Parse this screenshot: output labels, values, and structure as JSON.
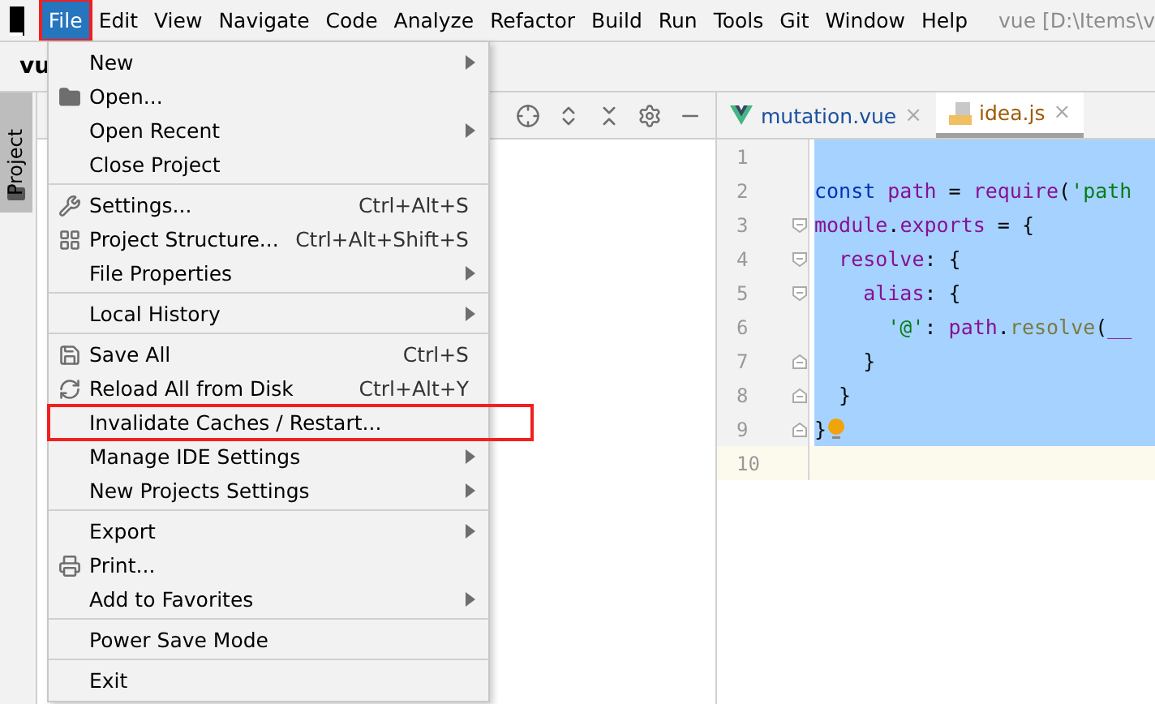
{
  "menu_bar": {
    "items": [
      {
        "label": "File",
        "selected": true,
        "annotated": true
      },
      {
        "label": "Edit",
        "selected": false,
        "annotated": false
      },
      {
        "label": "View",
        "selected": false,
        "annotated": false
      },
      {
        "label": "Navigate",
        "selected": false,
        "annotated": false
      },
      {
        "label": "Code",
        "selected": false,
        "annotated": false
      },
      {
        "label": "Analyze",
        "selected": false,
        "annotated": false
      },
      {
        "label": "Refactor",
        "selected": false,
        "annotated": false
      },
      {
        "label": "Build",
        "selected": false,
        "annotated": false
      },
      {
        "label": "Run",
        "selected": false,
        "annotated": false
      },
      {
        "label": "Tools",
        "selected": false,
        "annotated": false
      },
      {
        "label": "Git",
        "selected": false,
        "annotated": false
      },
      {
        "label": "Window",
        "selected": false,
        "annotated": false
      },
      {
        "label": "Help",
        "selected": false,
        "annotated": false
      }
    ],
    "window_title": "vue [D:\\Items\\v"
  },
  "project_title": "vu",
  "sidebar": {
    "tab": "Project"
  },
  "file_menu": {
    "groups": [
      [
        {
          "label": "New",
          "kind": "plain",
          "submenu": true,
          "annotated": false
        },
        {
          "label": "Open...",
          "kind": "folder",
          "submenu": false,
          "annotated": false
        },
        {
          "label": "Open Recent",
          "kind": "plain",
          "submenu": true,
          "annotated": false
        },
        {
          "label": "Close Project",
          "kind": "plain",
          "submenu": false,
          "annotated": false
        }
      ],
      [
        {
          "label": "Settings...",
          "kind": "wrench",
          "shortcut": "Ctrl+Alt+S",
          "submenu": false,
          "annotated": false
        },
        {
          "label": "Project Structure...",
          "kind": "structure",
          "shortcut": "Ctrl+Alt+Shift+S",
          "submenu": false,
          "annotated": false
        },
        {
          "label": "File Properties",
          "kind": "plain",
          "submenu": true,
          "annotated": false
        }
      ],
      [
        {
          "label": "Local History",
          "kind": "plain",
          "submenu": true,
          "annotated": false
        }
      ],
      [
        {
          "label": "Save All",
          "kind": "save",
          "shortcut": "Ctrl+S",
          "submenu": false,
          "annotated": false
        },
        {
          "label": "Reload All from Disk",
          "kind": "reload",
          "shortcut": "Ctrl+Alt+Y",
          "submenu": false,
          "annotated": false
        },
        {
          "label": "Invalidate Caches / Restart...",
          "kind": "plain",
          "submenu": false,
          "annotated": true
        },
        {
          "label": "Manage IDE Settings",
          "kind": "plain",
          "submenu": true,
          "annotated": false
        },
        {
          "label": "New Projects Settings",
          "kind": "plain",
          "submenu": true,
          "annotated": false
        }
      ],
      [
        {
          "label": "Export",
          "kind": "plain",
          "submenu": true,
          "annotated": false
        },
        {
          "label": "Print...",
          "kind": "print",
          "submenu": false,
          "annotated": false
        },
        {
          "label": "Add to Favorites",
          "kind": "plain",
          "submenu": true,
          "annotated": false
        }
      ],
      [
        {
          "label": "Power Save Mode",
          "kind": "plain",
          "submenu": false,
          "annotated": false
        }
      ],
      [
        {
          "label": "Exit",
          "kind": "plain",
          "submenu": false,
          "annotated": false
        }
      ]
    ]
  },
  "editor_tabs": [
    {
      "label": "mutation.vue",
      "kind": "vue",
      "selected": false,
      "close": "×"
    },
    {
      "label": "idea.js",
      "kind": "js",
      "selected": true,
      "close": "×"
    }
  ],
  "editor": {
    "lines": [
      {
        "number": "1",
        "selected": true,
        "current": false,
        "bulb": false,
        "kind": "plain"
      },
      {
        "number": "2",
        "selected": true,
        "current": false,
        "bulb": false,
        "kind": "plain",
        "tokens": [
          {
            "kind": "keyword",
            "text": "const "
          },
          {
            "kind": "ident",
            "text": "path"
          },
          {
            "kind": "punct",
            "text": " = "
          },
          {
            "kind": "ident",
            "text": "require"
          },
          {
            "kind": "punct",
            "text": "("
          },
          {
            "kind": "string",
            "text": "'path"
          }
        ]
      },
      {
        "number": "3",
        "selected": true,
        "current": false,
        "bulb": false,
        "kind": "foldstart",
        "tokens": [
          {
            "kind": "ident",
            "text": "module"
          },
          {
            "kind": "punct",
            "text": "."
          },
          {
            "kind": "ident",
            "text": "exports"
          },
          {
            "kind": "punct",
            "text": " = {"
          }
        ]
      },
      {
        "number": "4",
        "selected": true,
        "current": false,
        "bulb": false,
        "kind": "foldstart",
        "tokens": [
          {
            "kind": "ident",
            "text": "  resolve"
          },
          {
            "kind": "punct",
            "text": ": {"
          }
        ]
      },
      {
        "number": "5",
        "selected": true,
        "current": false,
        "bulb": false,
        "kind": "foldstart",
        "tokens": [
          {
            "kind": "ident",
            "text": "    alias"
          },
          {
            "kind": "punct",
            "text": ": {"
          }
        ]
      },
      {
        "number": "6",
        "selected": true,
        "current": false,
        "bulb": false,
        "kind": "plain",
        "tokens": [
          {
            "kind": "string",
            "text": "      '@'"
          },
          {
            "kind": "punct",
            "text": ": "
          },
          {
            "kind": "ident",
            "text": "path"
          },
          {
            "kind": "punct",
            "text": "."
          },
          {
            "kind": "func",
            "text": "resolve"
          },
          {
            "kind": "punct",
            "text": "("
          },
          {
            "kind": "ident",
            "text": "__"
          }
        ]
      },
      {
        "number": "7",
        "selected": true,
        "current": false,
        "bulb": false,
        "kind": "foldend",
        "tokens": [
          {
            "kind": "punct",
            "text": "    }"
          }
        ]
      },
      {
        "number": "8",
        "selected": true,
        "current": false,
        "bulb": false,
        "kind": "foldend",
        "tokens": [
          {
            "kind": "punct",
            "text": "  }"
          }
        ]
      },
      {
        "number": "9",
        "selected": true,
        "current": false,
        "bulb": true,
        "kind": "foldend",
        "tokens": [
          {
            "kind": "punct",
            "text": "}"
          }
        ]
      },
      {
        "number": "10",
        "selected": false,
        "current": true,
        "bulb": false,
        "kind": "plain"
      }
    ]
  }
}
